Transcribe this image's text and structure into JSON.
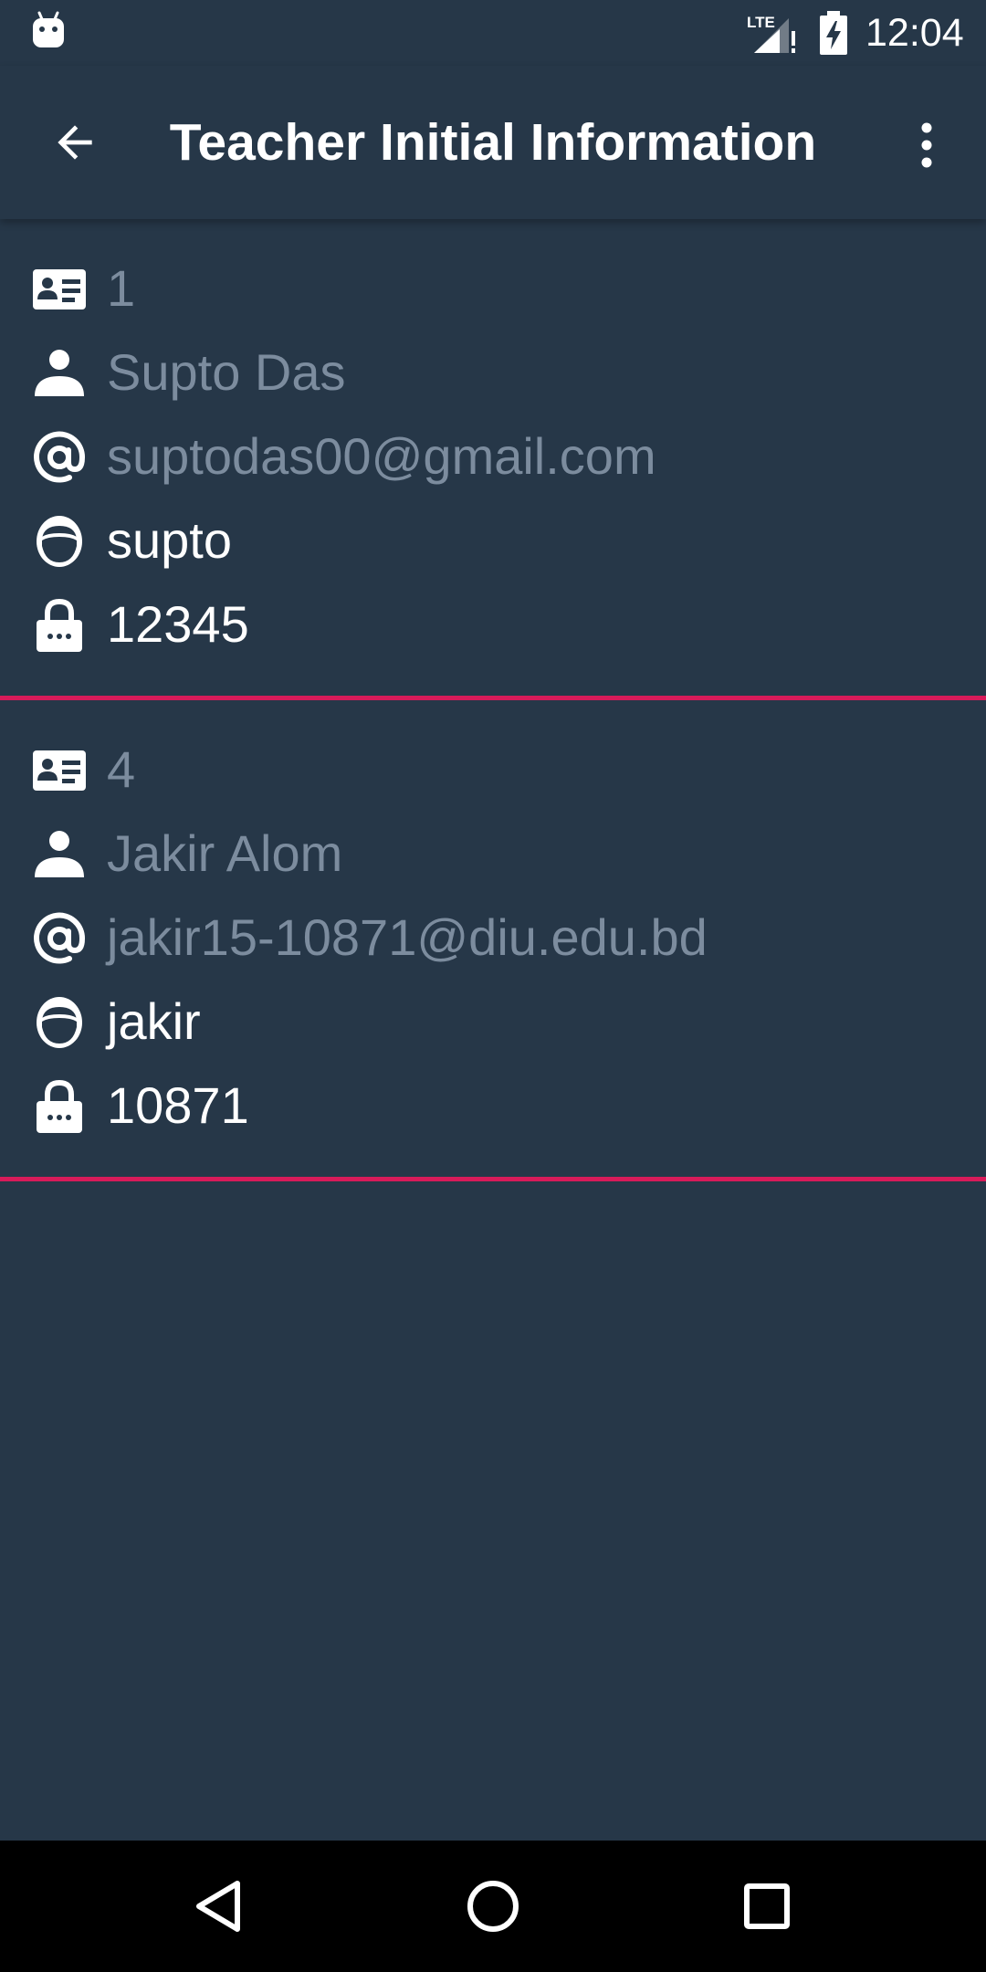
{
  "status_bar": {
    "time": "12:04",
    "network": "LTE",
    "icons": [
      "android-icon",
      "lte-signal-icon",
      "battery-charging-icon"
    ]
  },
  "app_bar": {
    "title": "Teacher Initial Information",
    "icons": [
      "arrow-back-icon",
      "more-vert-icon"
    ]
  },
  "teachers": [
    {
      "id": "1",
      "name": "Supto Das",
      "email": "suptodas00@gmail.com",
      "initial": "supto",
      "password": "12345"
    },
    {
      "id": "4",
      "name": "Jakir Alom",
      "email": "jakir15-10871@diu.edu.bd",
      "initial": "jakir",
      "password": "10871"
    }
  ],
  "row_icons": [
    "id-card-icon",
    "person-icon",
    "at-sign-icon",
    "face-icon",
    "lock-icon"
  ],
  "nav_bar": {
    "icons": [
      "nav-back-icon",
      "nav-home-icon",
      "nav-recents-icon"
    ]
  },
  "colors": {
    "background": "#263748",
    "divider": "#d81b5a",
    "dim_text": "#7c8c9e",
    "bright_text": "#ffffff",
    "nav_background": "#000000"
  }
}
